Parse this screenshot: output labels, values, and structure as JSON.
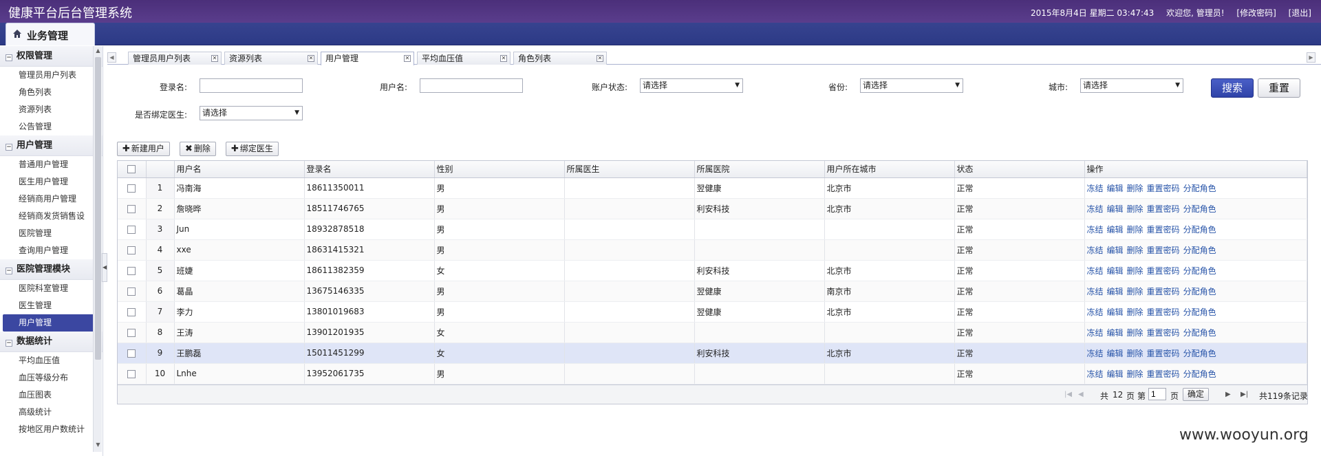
{
  "header": {
    "title": "健康平台后台管理系统",
    "datetime": "2015年8月4日 星期二 03:47:43",
    "welcome": "欢迎您, 管理员!",
    "change_password": "[修改密码]",
    "logout": "[退出]"
  },
  "module_tab": {
    "label": "业务管理",
    "icon": "home-icon"
  },
  "sidebar": {
    "groups": [
      {
        "title": "权限管理",
        "items": [
          "管理员用户列表",
          "角色列表",
          "资源列表",
          "公告管理"
        ]
      },
      {
        "title": "用户管理",
        "items": [
          "普通用户管理",
          "医生用户管理",
          "经销商用户管理",
          "经销商发货销售设",
          "医院管理",
          "查询用户管理"
        ]
      },
      {
        "title": "医院管理模块",
        "items": [
          "医院科室管理",
          "医生管理",
          "用户管理"
        ]
      },
      {
        "title": "数据统计",
        "items": [
          "平均血压值",
          "血压等级分布",
          "血压图表",
          "高级统计",
          "按地区用户数统计"
        ]
      }
    ],
    "active_item": "用户管理"
  },
  "tabs": [
    {
      "label": "管理员用户列表",
      "active": false
    },
    {
      "label": "资源列表",
      "active": false
    },
    {
      "label": "用户管理",
      "active": true
    },
    {
      "label": "平均血压值",
      "active": false
    },
    {
      "label": "角色列表",
      "active": false
    }
  ],
  "search": {
    "login_name_label": "登录名:",
    "login_name_value": "",
    "user_name_label": "用户名:",
    "user_name_value": "",
    "account_status_label": "账户状态:",
    "account_status_value": "请选择",
    "province_label": "省份:",
    "province_value": "请选择",
    "city_label": "城市:",
    "city_value": "请选择",
    "bind_doctor_label": "是否绑定医生:",
    "bind_doctor_value": "请选择",
    "search_button": "搜索",
    "reset_button": "重置"
  },
  "toolbar": {
    "new_user": "新建用户",
    "delete": "删除",
    "bind_doctor": "绑定医生"
  },
  "table": {
    "columns": [
      "用户名",
      "登录名",
      "性别",
      "所属医生",
      "所属医院",
      "用户所在城市",
      "状态",
      "操作"
    ],
    "rows": [
      {
        "no": "1",
        "name": "冯南海",
        "login": "18611350011",
        "gender": "男",
        "doctor": "",
        "hospital": "翌健康",
        "city": "北京市",
        "status": "正常"
      },
      {
        "no": "2",
        "name": "詹晓晔",
        "login": "18511746765",
        "gender": "男",
        "doctor": "",
        "hospital": "利安科技",
        "city": "北京市",
        "status": "正常"
      },
      {
        "no": "3",
        "name": "Jun",
        "login": "18932878518",
        "gender": "男",
        "doctor": "",
        "hospital": "",
        "city": "",
        "status": "正常"
      },
      {
        "no": "4",
        "name": "xxe",
        "login": "18631415321",
        "gender": "男",
        "doctor": "",
        "hospital": "",
        "city": "",
        "status": "正常"
      },
      {
        "no": "5",
        "name": "班婕",
        "login": "18611382359",
        "gender": "女",
        "doctor": "",
        "hospital": "利安科技",
        "city": "北京市",
        "status": "正常"
      },
      {
        "no": "6",
        "name": "葛晶",
        "login": "13675146335",
        "gender": "男",
        "doctor": "",
        "hospital": "翌健康",
        "city": "南京市",
        "status": "正常"
      },
      {
        "no": "7",
        "name": "李力",
        "login": "13801019683",
        "gender": "男",
        "doctor": "",
        "hospital": "翌健康",
        "city": "北京市",
        "status": "正常"
      },
      {
        "no": "8",
        "name": "王涛",
        "login": "13901201935",
        "gender": "女",
        "doctor": "",
        "hospital": "",
        "city": "",
        "status": "正常"
      },
      {
        "no": "9",
        "name": "王鹏磊",
        "login": "15011451299",
        "gender": "女",
        "doctor": "",
        "hospital": "利安科技",
        "city": "北京市",
        "status": "正常"
      },
      {
        "no": "10",
        "name": "Lnhe",
        "login": "13952061735",
        "gender": "男",
        "doctor": "",
        "hospital": "",
        "city": "",
        "status": "正常"
      }
    ],
    "selected_row": 9,
    "ops": [
      "冻结",
      "编辑",
      "删除",
      "重置密码",
      "分配角色"
    ]
  },
  "pager": {
    "total_pages_prefix": "共",
    "total_pages": "12",
    "total_pages_suffix": "页",
    "page_prefix": "第",
    "current_page": "1",
    "page_suffix": "页",
    "go_button": "确定",
    "total_records": "共119条记录"
  },
  "watermark": "www.wooyun.org"
}
